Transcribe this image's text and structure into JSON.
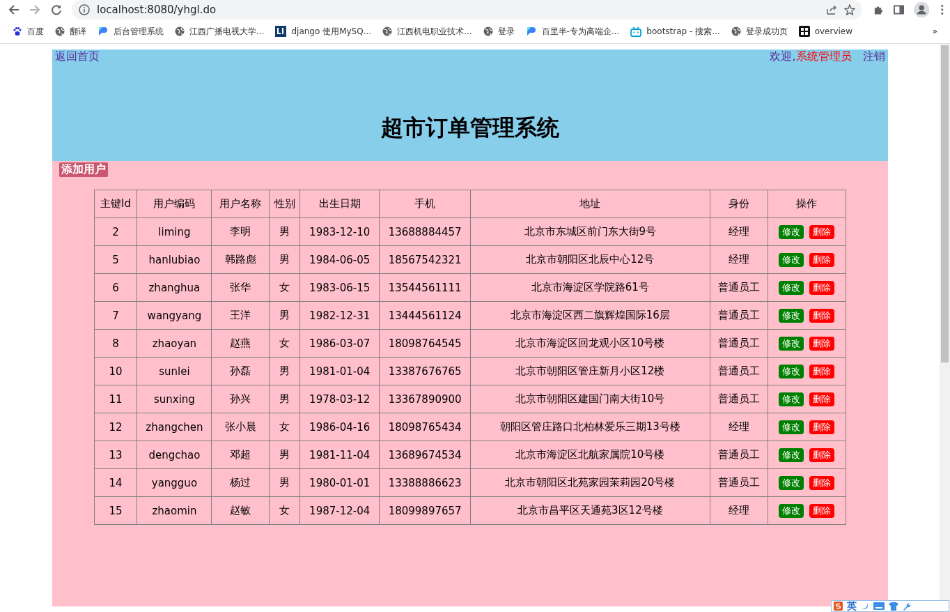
{
  "browser": {
    "url": "localhost:8080/yhgl.do",
    "bookmarks": [
      {
        "label": "百度",
        "kind": "paw"
      },
      {
        "label": "翻译",
        "kind": "globe"
      },
      {
        "label": "后台管理系统",
        "kind": "logo"
      },
      {
        "label": "江西广播电视大学...",
        "kind": "globe"
      },
      {
        "label": "django 使用MySQ...",
        "kind": "square"
      },
      {
        "label": "江西机电职业技术...",
        "kind": "globe"
      },
      {
        "label": "登录",
        "kind": "globe"
      },
      {
        "label": "百里半-专为高端企...",
        "kind": "logo"
      },
      {
        "label": "bootstrap - 搜索...",
        "kind": "tv"
      },
      {
        "label": "登录成功页",
        "kind": "globe"
      },
      {
        "label": "overview",
        "kind": "tile"
      }
    ],
    "more": "»"
  },
  "header": {
    "home_link": "返回首页",
    "welcome": "欢迎,",
    "user": "系统管理员",
    "logout": "注销",
    "title": "超市订单管理系统"
  },
  "add_user": "添加用户",
  "table": {
    "columns": [
      "主键Id",
      "用户编码",
      "用户名称",
      "性别",
      "出生日期",
      "手机",
      "地址",
      "身份",
      "操作"
    ],
    "rows": [
      {
        "cells": [
          "2",
          "liming",
          "李明",
          "男",
          "1983-12-10",
          "13688884457",
          "北京市东城区前门东大街9号",
          "经理"
        ],
        "edit": "修改",
        "delete": "删除"
      },
      {
        "cells": [
          "5",
          "hanlubiao",
          "韩路彪",
          "男",
          "1984-06-05",
          "18567542321",
          "北京市朝阳区北辰中心12号",
          "经理"
        ],
        "edit": "修改",
        "delete": "删除"
      },
      {
        "cells": [
          "6",
          "zhanghua",
          "张华",
          "女",
          "1983-06-15",
          "13544561111",
          "北京市海淀区学院路61号",
          "普通员工"
        ],
        "edit": "修改",
        "delete": "删除"
      },
      {
        "cells": [
          "7",
          "wangyang",
          "王洋",
          "男",
          "1982-12-31",
          "13444561124",
          "北京市海淀区西二旗辉煌国际16层",
          "普通员工"
        ],
        "edit": "修改",
        "delete": "删除"
      },
      {
        "cells": [
          "8",
          "zhaoyan",
          "赵燕",
          "女",
          "1986-03-07",
          "18098764545",
          "北京市海淀区回龙观小区10号楼",
          "普通员工"
        ],
        "edit": "修改",
        "delete": "删除"
      },
      {
        "cells": [
          "10",
          "sunlei",
          "孙磊",
          "男",
          "1981-01-04",
          "13387676765",
          "北京市朝阳区管庄新月小区12楼",
          "普通员工"
        ],
        "edit": "修改",
        "delete": "删除"
      },
      {
        "cells": [
          "11",
          "sunxing",
          "孙兴",
          "男",
          "1978-03-12",
          "13367890900",
          "北京市朝阳区建国门南大街10号",
          "普通员工"
        ],
        "edit": "修改",
        "delete": "删除"
      },
      {
        "cells": [
          "12",
          "zhangchen",
          "张小晨",
          "女",
          "1986-04-16",
          "18098765434",
          "朝阳区管庄路口北柏林爱乐三期13号楼",
          "经理"
        ],
        "edit": "修改",
        "delete": "删除"
      },
      {
        "cells": [
          "13",
          "dengchao",
          "邓超",
          "男",
          "1981-11-04",
          "13689674534",
          "北京市海淀区北航家属院10号楼",
          "普通员工"
        ],
        "edit": "修改",
        "delete": "删除"
      },
      {
        "cells": [
          "14",
          "yangguo",
          "杨过",
          "男",
          "1980-01-01",
          "13388886623",
          "北京市朝阳区北苑家园茉莉园20号楼",
          "普通员工"
        ],
        "edit": "修改",
        "delete": "删除"
      },
      {
        "cells": [
          "15",
          "zhaomin",
          "赵敏",
          "女",
          "1987-12-04",
          "18099897657",
          "北京市昌平区天通苑3区12号楼",
          "经理"
        ],
        "edit": "修改",
        "delete": "删除"
      }
    ]
  },
  "ime": {
    "mode": "英"
  }
}
